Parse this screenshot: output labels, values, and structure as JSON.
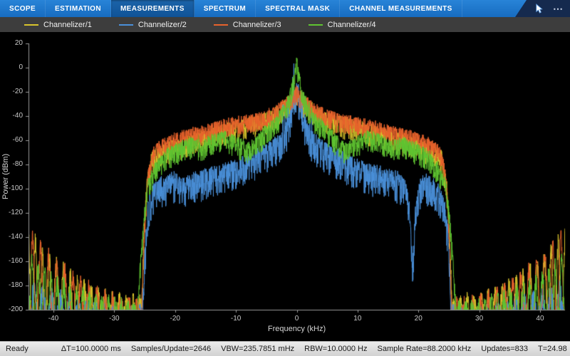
{
  "tabbar": {
    "tabs": [
      {
        "label": "SCOPE",
        "active": false
      },
      {
        "label": "ESTIMATION",
        "active": false
      },
      {
        "label": "MEASUREMENTS",
        "active": true
      },
      {
        "label": "SPECTRUM",
        "active": false
      },
      {
        "label": "SPECTRAL MASK",
        "active": false
      },
      {
        "label": "CHANNEL MEASUREMENTS",
        "active": false
      }
    ],
    "more_label": "⋯"
  },
  "statusbar": {
    "items": [
      "Ready",
      "ΔT=100.0000 ms",
      "Samples/Update=2646",
      "VBW=235.7851 mHz",
      "RBW=10.0000 Hz",
      "Sample Rate=88.2000 kHz",
      "Updates=833",
      "T=24.98"
    ]
  },
  "chart_data": {
    "type": "line",
    "title": "",
    "xlabel": "Frequency (kHz)",
    "ylabel": "Power (dBm)",
    "xlim": [
      -44.1,
      44.1
    ],
    "ylim": [
      -200,
      20
    ],
    "xticks": [
      -40,
      -30,
      -20,
      -10,
      0,
      10,
      20,
      30,
      40
    ],
    "yticks": [
      20,
      0,
      -20,
      -40,
      -60,
      -80,
      -100,
      -120,
      -140,
      -160,
      -180,
      -200
    ],
    "grid": false,
    "background": "#000000",
    "axis_color": "#9a9a9a",
    "legend_position": "top",
    "series": [
      {
        "name": "Channelizer/1",
        "color": "#d8c42c",
        "seed": 11,
        "noise": 9,
        "envelope": [
          [
            -25.6,
            -200
          ],
          [
            -25.2,
            -148
          ],
          [
            -24.7,
            -95
          ],
          [
            -23.8,
            -70
          ],
          [
            -22,
            -64
          ],
          [
            -19,
            -59
          ],
          [
            -16,
            -54
          ],
          [
            -13,
            -49
          ],
          [
            -10,
            -45
          ],
          [
            -7,
            -41
          ],
          [
            -5,
            -38
          ],
          [
            -3.5,
            -34
          ],
          [
            -2.5,
            -30
          ],
          [
            -1.5,
            -26
          ],
          [
            -0.8,
            -23
          ],
          [
            0,
            -17
          ],
          [
            0.8,
            -23
          ],
          [
            1.5,
            -26
          ],
          [
            2.5,
            -30
          ],
          [
            3.5,
            -34
          ],
          [
            5,
            -38
          ],
          [
            7,
            -41
          ],
          [
            10,
            -45
          ],
          [
            13,
            -49
          ],
          [
            16,
            -54
          ],
          [
            19,
            -59
          ],
          [
            22,
            -64
          ],
          [
            23.8,
            -70
          ],
          [
            24.7,
            -95
          ],
          [
            25.2,
            -148
          ],
          [
            25.6,
            -200
          ]
        ],
        "comb": {
          "start": 25.6,
          "floor": -202,
          "base": 14,
          "edge": 56,
          "period": 1.15,
          "phase": 0.4,
          "sharp": 2.5
        }
      },
      {
        "name": "Channelizer/2",
        "color": "#4a90d9",
        "seed": 22,
        "noise": 13,
        "envelope": [
          [
            -25.4,
            -200
          ],
          [
            -25,
            -152
          ],
          [
            -24.5,
            -112
          ],
          [
            -23.6,
            -97
          ],
          [
            -22.2,
            -91
          ],
          [
            -20.5,
            -87
          ],
          [
            -18.5,
            -90
          ],
          [
            -16.5,
            -87
          ],
          [
            -14.5,
            -84
          ],
          [
            -12.5,
            -81
          ],
          [
            -10.5,
            -78
          ],
          [
            -8.5,
            -73
          ],
          [
            -7,
            -69
          ],
          [
            -5.5,
            -65
          ],
          [
            -4.2,
            -61
          ],
          [
            -3.2,
            -57
          ],
          [
            -2.4,
            -52
          ],
          [
            -1.6,
            -45
          ],
          [
            -1,
            -34
          ],
          [
            -0.5,
            -22
          ],
          [
            0,
            -13
          ],
          [
            0.5,
            -22
          ],
          [
            1,
            -34
          ],
          [
            1.6,
            -45
          ],
          [
            2.4,
            -52
          ],
          [
            3.2,
            -57
          ],
          [
            4.2,
            -61
          ],
          [
            5.5,
            -65
          ],
          [
            7,
            -69
          ],
          [
            8.5,
            -73
          ],
          [
            10.5,
            -78
          ],
          [
            12.5,
            -81
          ],
          [
            14.5,
            -84
          ],
          [
            16.5,
            -87
          ],
          [
            17.8,
            -93
          ],
          [
            18.6,
            -112
          ],
          [
            19.1,
            -158
          ],
          [
            19.5,
            -116
          ],
          [
            20.2,
            -92
          ],
          [
            21.2,
            -89
          ],
          [
            22.2,
            -91
          ],
          [
            23.2,
            -97
          ],
          [
            24.2,
            -106
          ],
          [
            24.8,
            -130
          ],
          [
            25.1,
            -158
          ],
          [
            25.4,
            -200
          ]
        ],
        "comb": {
          "start": 25.4,
          "floor": -202,
          "base": 6,
          "edge": 22,
          "period": 1.45,
          "phase": 2.2,
          "sharp": 2
        },
        "spikes": {
          "halfwidth": 3,
          "amp": 26,
          "prob": 0.18
        }
      },
      {
        "name": "Channelizer/3",
        "color": "#e8632c",
        "seed": 33,
        "noise": 8,
        "envelope": [
          [
            -25.5,
            -200
          ],
          [
            -25.1,
            -138
          ],
          [
            -24.5,
            -84
          ],
          [
            -23.4,
            -64
          ],
          [
            -21,
            -57
          ],
          [
            -18,
            -52
          ],
          [
            -15,
            -48
          ],
          [
            -12,
            -44
          ],
          [
            -9,
            -41
          ],
          [
            -6,
            -38
          ],
          [
            -4,
            -34
          ],
          [
            -2.8,
            -30
          ],
          [
            -1.8,
            -26
          ],
          [
            -1,
            -22
          ],
          [
            0,
            -16
          ],
          [
            1,
            -22
          ],
          [
            1.8,
            -26
          ],
          [
            2.8,
            -30
          ],
          [
            4,
            -34
          ],
          [
            6,
            -38
          ],
          [
            9,
            -41
          ],
          [
            12,
            -44
          ],
          [
            15,
            -48
          ],
          [
            18,
            -52
          ],
          [
            21,
            -57
          ],
          [
            23.4,
            -64
          ],
          [
            24.5,
            -84
          ],
          [
            25.1,
            -138
          ],
          [
            25.5,
            -200
          ]
        ],
        "comb": {
          "start": 25.5,
          "floor": -202,
          "base": 12,
          "edge": 60,
          "period": 1.32,
          "phase": 1.9,
          "sharp": 2.5
        }
      },
      {
        "name": "Channelizer/4",
        "color": "#5fc431",
        "seed": 44,
        "noise": 9,
        "envelope": [
          [
            -26.2,
            -200
          ],
          [
            -25.7,
            -158
          ],
          [
            -25.1,
            -118
          ],
          [
            -24.4,
            -92
          ],
          [
            -23.2,
            -79
          ],
          [
            -21.5,
            -69
          ],
          [
            -19.5,
            -63
          ],
          [
            -17.5,
            -58
          ],
          [
            -15.5,
            -61
          ],
          [
            -13.5,
            -55
          ],
          [
            -11.5,
            -53
          ],
          [
            -9.5,
            -59
          ],
          [
            -8,
            -63
          ],
          [
            -6.5,
            -57
          ],
          [
            -5.5,
            -51
          ],
          [
            -4.5,
            -46
          ],
          [
            -3.5,
            -41
          ],
          [
            -2.6,
            -35
          ],
          [
            -1.8,
            -28
          ],
          [
            -1.2,
            -21
          ],
          [
            -0.7,
            -11
          ],
          [
            -0.35,
            -3
          ],
          [
            0,
            9
          ],
          [
            0.35,
            -3
          ],
          [
            0.7,
            -11
          ],
          [
            1.2,
            -21
          ],
          [
            1.8,
            -28
          ],
          [
            2.6,
            -35
          ],
          [
            3.5,
            -41
          ],
          [
            4.5,
            -46
          ],
          [
            5.5,
            -51
          ],
          [
            6.5,
            -57
          ],
          [
            8,
            -63
          ],
          [
            9.5,
            -59
          ],
          [
            11.5,
            -53
          ],
          [
            13.5,
            -55
          ],
          [
            15.5,
            -61
          ],
          [
            17.5,
            -58
          ],
          [
            19.5,
            -63
          ],
          [
            21.5,
            -69
          ],
          [
            23.2,
            -79
          ],
          [
            24.4,
            -92
          ],
          [
            25.1,
            -118
          ],
          [
            25.7,
            -158
          ],
          [
            26.2,
            -200
          ]
        ],
        "comb": {
          "start": 26.2,
          "floor": -202,
          "base": 10,
          "edge": 40,
          "period": 1.05,
          "phase": 0.1,
          "sharp": 2.2
        }
      }
    ]
  }
}
